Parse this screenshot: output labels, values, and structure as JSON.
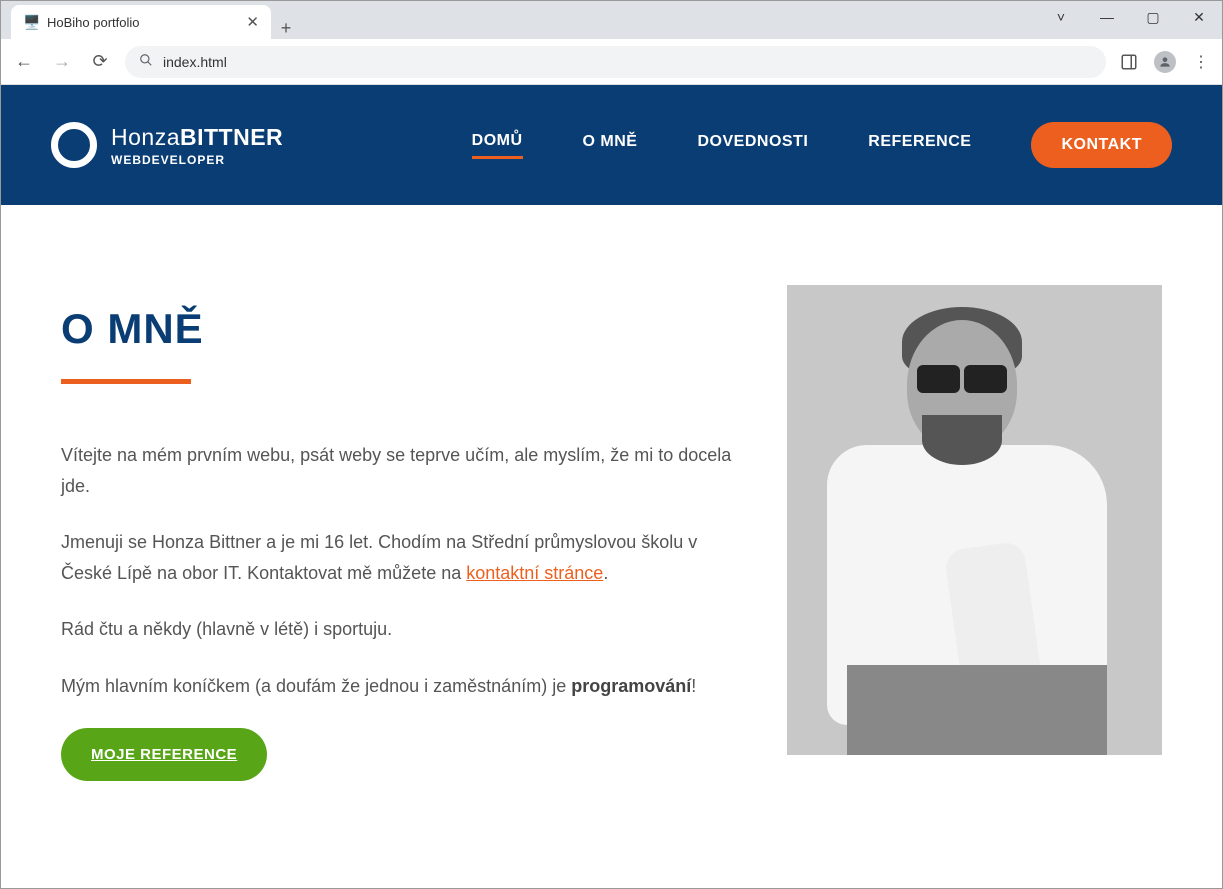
{
  "browser": {
    "tab_title": "HoBiho portfolio",
    "url": "index.html"
  },
  "header": {
    "logo_name_light": "Honza",
    "logo_name_bold": "BITTNER",
    "logo_subtitle": "WEBDEVELOPER",
    "nav": [
      "DOMŮ",
      "O MNĚ",
      "DOVEDNOSTI",
      "REFERENCE"
    ],
    "contact_btn": "KONTAKT"
  },
  "about": {
    "heading": "O MNĚ",
    "p1": "Vítejte na mém prvním webu, psát weby se teprve učím, ale myslím, že mi to docela jde.",
    "p2_a": "Jmenuji se Honza Bittner a je mi 16 let. Chodím na Střední průmyslovou školu v České Lípě na obor IT. Kontaktovat mě můžete na ",
    "p2_link": "kontaktní stránce",
    "p2_b": ".",
    "p3": "Rád čtu a někdy (hlavně v létě) i sportuju.",
    "p4_a": "Mým hlavním koníčkem (a doufám že jednou i zaměstnáním) je ",
    "p4_strong": "programování",
    "p4_b": "!",
    "ref_btn": "MOJE REFERENCE"
  }
}
